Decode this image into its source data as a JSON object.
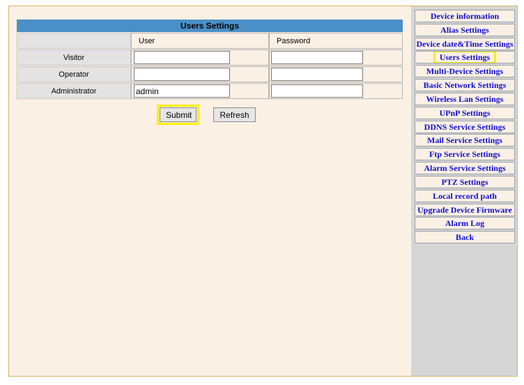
{
  "users_settings": {
    "title": "Users Settings",
    "columns": {
      "user": "User",
      "password": "Password"
    },
    "rows": [
      {
        "label": "Visitor",
        "user": "",
        "password": ""
      },
      {
        "label": "Operator",
        "user": "",
        "password": ""
      },
      {
        "label": "Administrator",
        "user": "admin",
        "password": ""
      }
    ],
    "buttons": {
      "submit": "Submit",
      "refresh": "Refresh"
    }
  },
  "sidebar": {
    "items": [
      {
        "label": "Device information"
      },
      {
        "label": "Alias Settings"
      },
      {
        "label": "Device date&Time Settings"
      },
      {
        "label": "Users Settings",
        "active": true
      },
      {
        "label": "Multi-Device Settings"
      },
      {
        "label": "Basic Network Settings"
      },
      {
        "label": "Wireless Lan Settings"
      },
      {
        "label": "UPnP Settings"
      },
      {
        "label": "DDNS Service Settings"
      },
      {
        "label": "Mail Service Settings"
      },
      {
        "label": "Ftp Service Settings"
      },
      {
        "label": "Alarm Service Settings"
      },
      {
        "label": "PTZ Settings"
      },
      {
        "label": "Local record path"
      },
      {
        "label": "Upgrade Device Firmware"
      },
      {
        "label": "Alarm Log"
      },
      {
        "label": "Back"
      }
    ]
  },
  "colors": {
    "header_bar": "#4a8fc7",
    "link": "#1010d0",
    "highlight": "#ffee00",
    "panel_bg": "#fbf0e4",
    "sidebar_bg": "#d6d6d6"
  }
}
